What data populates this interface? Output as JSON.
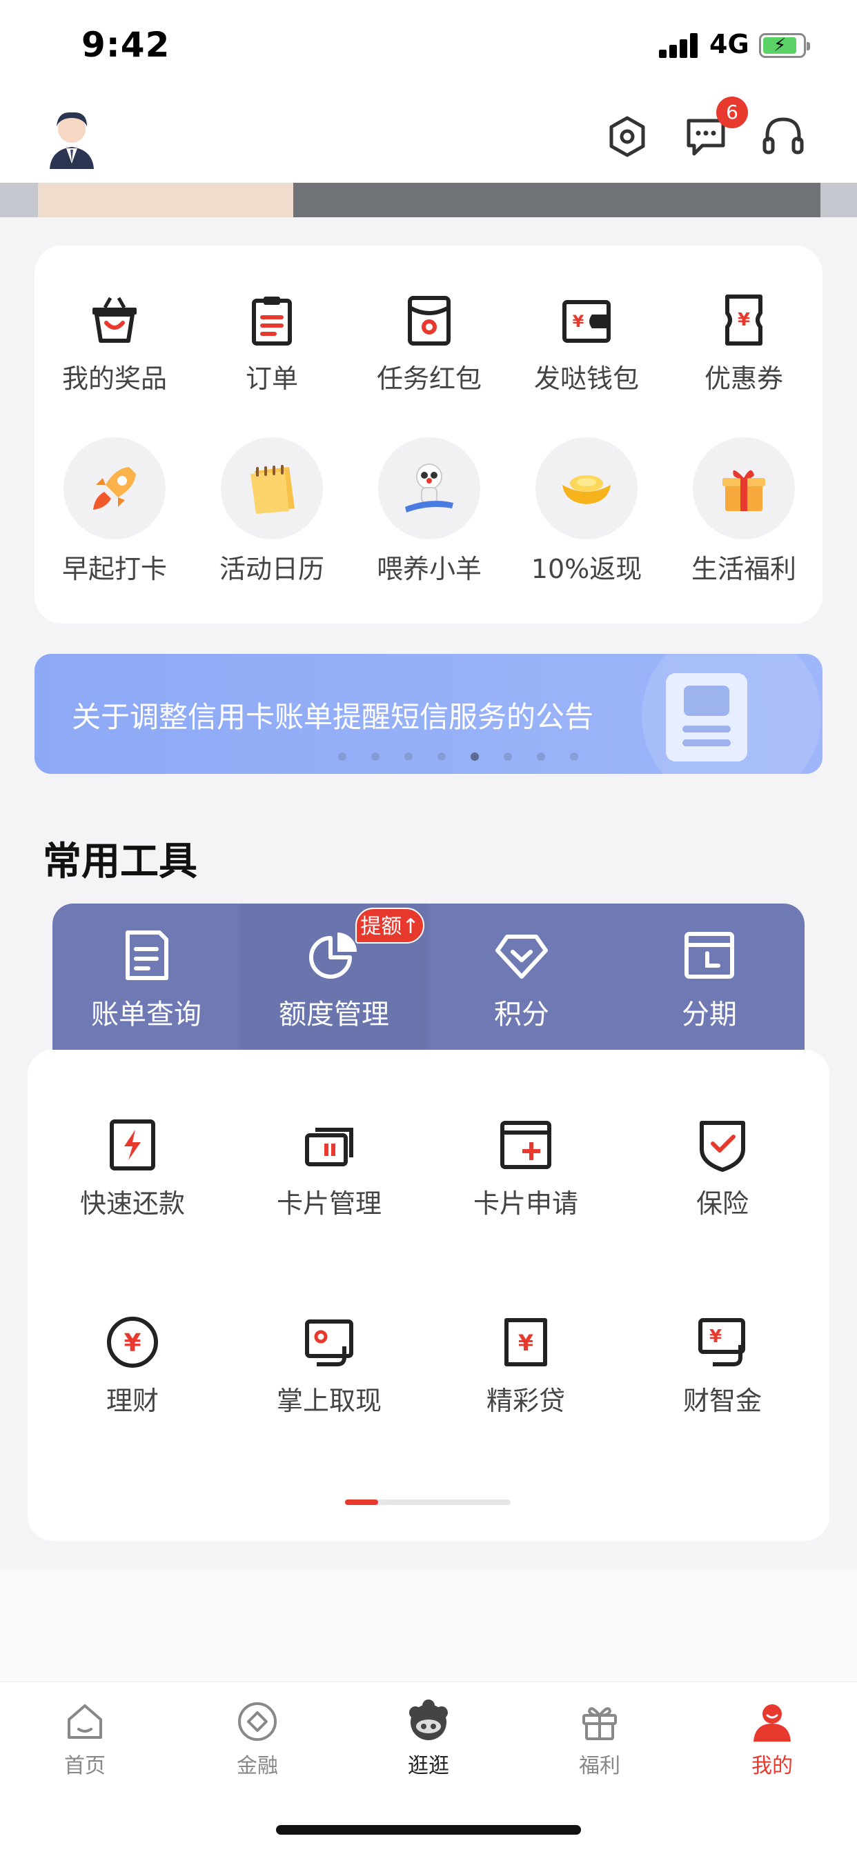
{
  "status_bar": {
    "time": "9:42",
    "network": "4G"
  },
  "header": {
    "message_badge": "6"
  },
  "quick_grid": {
    "row1": [
      {
        "label": "我的奖品",
        "icon": "basket-icon"
      },
      {
        "label": "订单",
        "icon": "clipboard-icon"
      },
      {
        "label": "任务红包",
        "icon": "red-envelope-icon"
      },
      {
        "label": "发哒钱包",
        "icon": "wallet-icon"
      },
      {
        "label": "优惠券",
        "icon": "coupon-icon"
      }
    ],
    "row2": [
      {
        "label": "早起打卡",
        "icon": "rocket-icon"
      },
      {
        "label": "活动日历",
        "icon": "calendar-icon"
      },
      {
        "label": "喂养小羊",
        "icon": "sheep-icon"
      },
      {
        "label": "10%返现",
        "icon": "gold-ingot-icon"
      },
      {
        "label": "生活福利",
        "icon": "gift-box-icon"
      }
    ]
  },
  "banner": {
    "text": "关于调整信用卡账单提醒短信服务的公告",
    "dot_count": 8,
    "active_dot": 5
  },
  "tools": {
    "title": "常用工具",
    "tabs": [
      {
        "label": "账单查询",
        "icon": "bill-icon"
      },
      {
        "label": "额度管理",
        "icon": "pie-chart-icon"
      },
      {
        "label": "积分",
        "icon": "diamond-icon"
      },
      {
        "label": "分期",
        "icon": "installment-icon"
      }
    ],
    "tab_badge": "提额↑",
    "items_row1": [
      {
        "label": "快速还款",
        "icon": "flash-pay-icon"
      },
      {
        "label": "卡片管理",
        "icon": "card-manage-icon"
      },
      {
        "label": "卡片申请",
        "icon": "card-apply-icon"
      },
      {
        "label": "保险",
        "icon": "shield-check-icon"
      }
    ],
    "items_row2": [
      {
        "label": "理财",
        "icon": "yuan-circle-icon"
      },
      {
        "label": "掌上取现",
        "icon": "cash-withdraw-icon"
      },
      {
        "label": "精彩贷",
        "icon": "loan-icon"
      },
      {
        "label": "财智金",
        "icon": "money-card-icon"
      }
    ],
    "scroll_progress": 0.2
  },
  "bottom_nav": [
    {
      "label": "首页",
      "icon": "home-icon"
    },
    {
      "label": "金融",
      "icon": "finance-icon"
    },
    {
      "label": "逛逛",
      "icon": "mascot-icon"
    },
    {
      "label": "福利",
      "icon": "gift-icon"
    },
    {
      "label": "我的",
      "icon": "profile-icon"
    }
  ],
  "colors": {
    "accent": "#e8392f",
    "tools_bar": "#6f79b3",
    "banner": "#8da9f5"
  }
}
